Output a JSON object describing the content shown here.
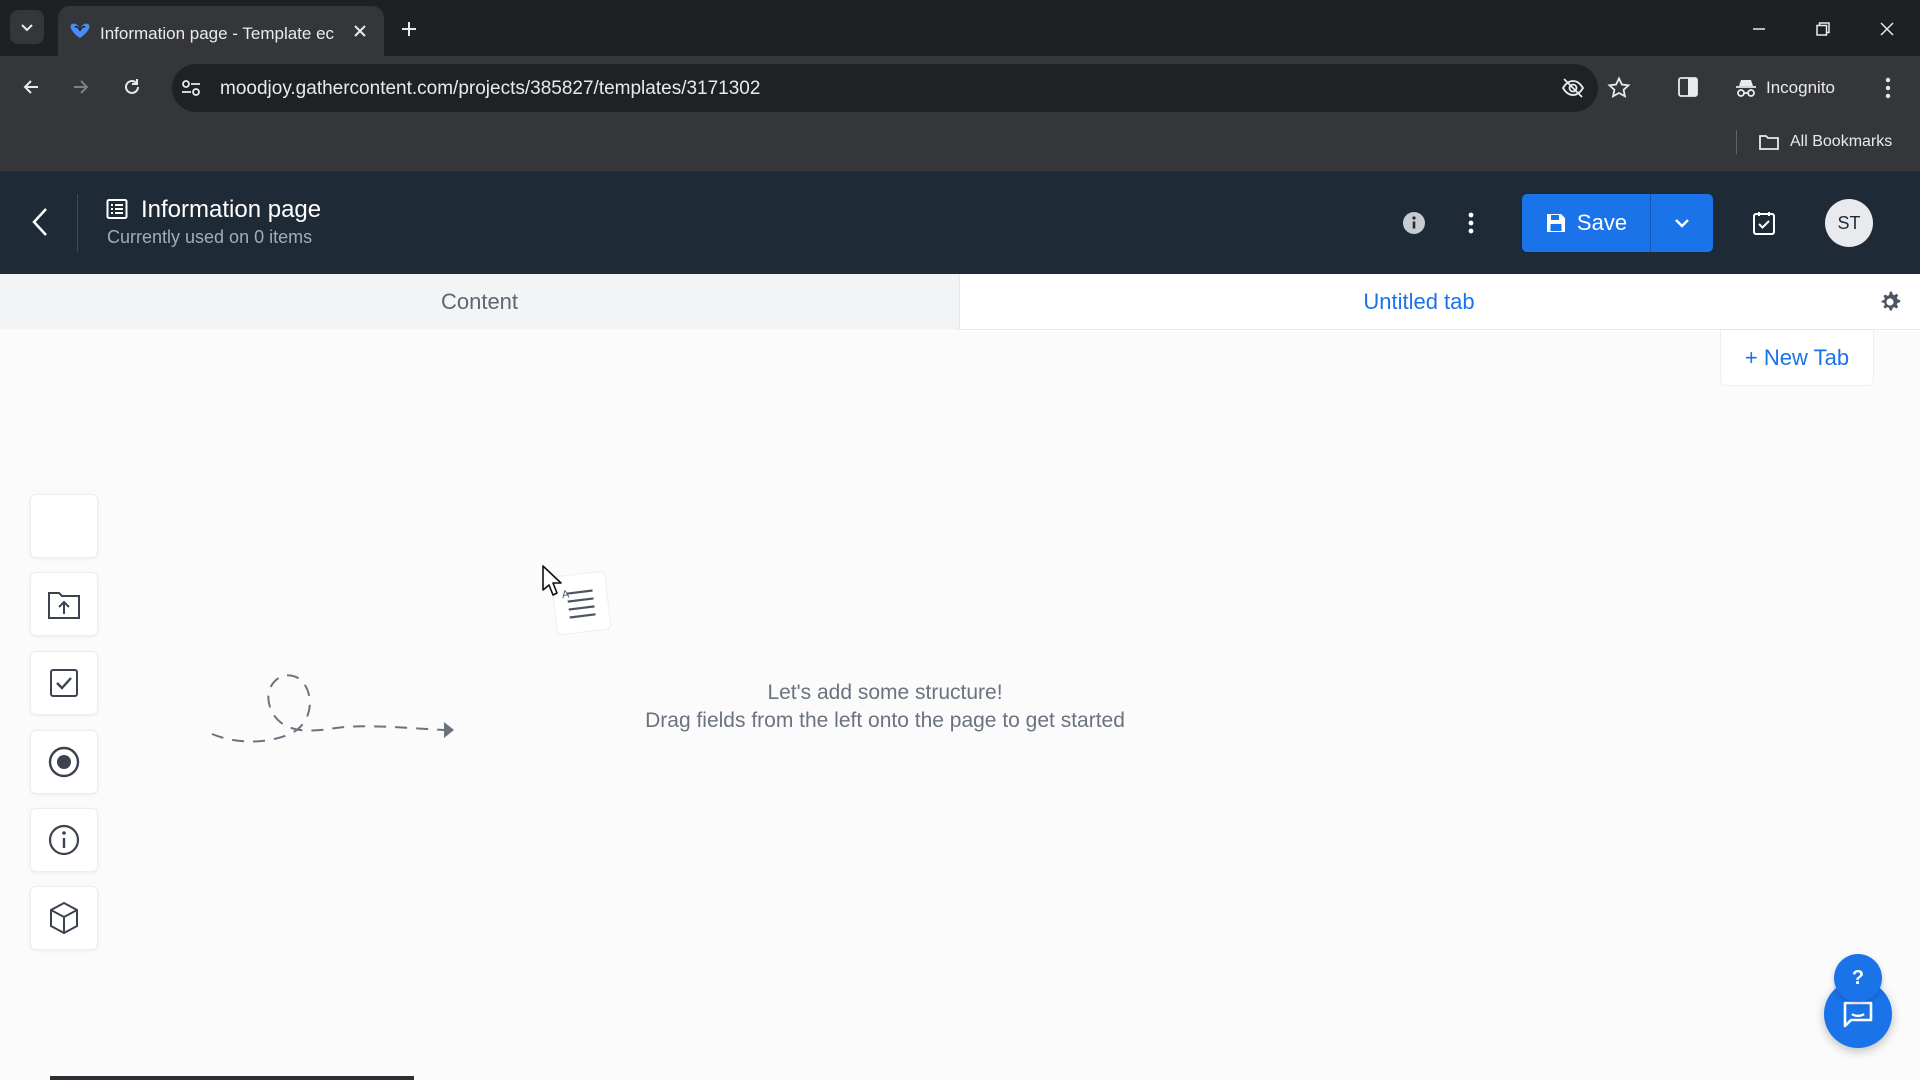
{
  "browser": {
    "tab_title": "Information page - Template ec",
    "url": "moodjoy.gathercontent.com/projects/385827/templates/3171302",
    "incognito_label": "Incognito",
    "bookmarks_label": "All Bookmarks"
  },
  "header": {
    "title": "Information page",
    "subtitle": "Currently used on 0 items",
    "save_label": "Save",
    "avatar_initials": "ST"
  },
  "tabs": [
    {
      "label": "Content"
    },
    {
      "label": "Untitled tab"
    }
  ],
  "new_tab_label": "+ New Tab",
  "empty_state": {
    "line1": "Let's add some structure!",
    "line2": "Drag fields from the left onto the page to get started"
  },
  "palette": [
    "blank-field",
    "upload-field",
    "checkbox-field",
    "radio-field",
    "guideline-field",
    "component-field"
  ],
  "help_label": "?",
  "colors": {
    "accent": "#1a73e8",
    "header_bg": "#1f2a37",
    "chrome_bg": "#35363a"
  }
}
